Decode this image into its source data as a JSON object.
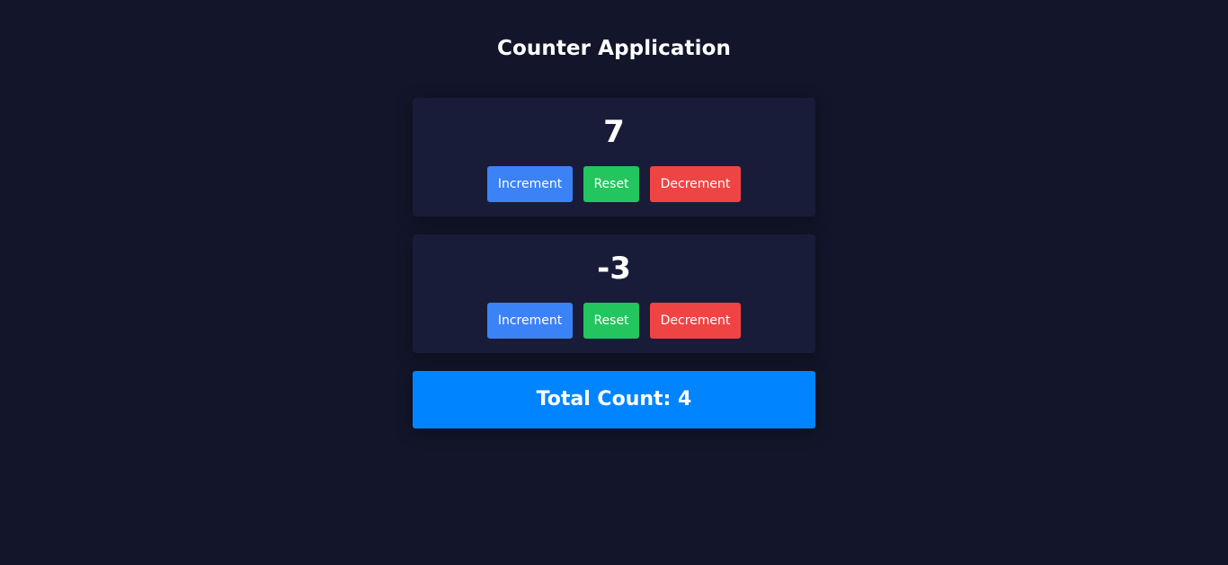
{
  "app": {
    "title": "Counter Application"
  },
  "counters": [
    {
      "value": "7",
      "increment_label": "Increment",
      "reset_label": "Reset",
      "decrement_label": "Decrement"
    },
    {
      "value": "-3",
      "increment_label": "Increment",
      "reset_label": "Reset",
      "decrement_label": "Decrement"
    }
  ],
  "total": {
    "label": "Total Count: 4"
  },
  "colors": {
    "background": "#13152a",
    "card": "#191c38",
    "increment": "#3b82f6",
    "reset": "#22c55e",
    "decrement": "#ef4444",
    "total": "#0084ff"
  }
}
